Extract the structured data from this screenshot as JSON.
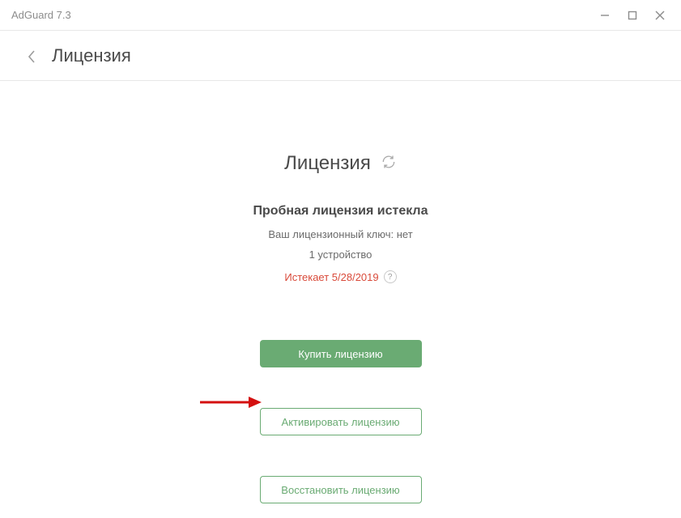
{
  "app": {
    "title": "AdGuard 7.3"
  },
  "header": {
    "title": "Лицензия"
  },
  "section": {
    "title": "Лицензия"
  },
  "status": {
    "trial_expired": "Пробная лицензия истекла",
    "key_line": "Ваш лицензионный ключ: нет",
    "devices_line": "1 устройство",
    "expires_text": "Истекает 5/28/2019",
    "help_symbol": "?"
  },
  "buttons": {
    "buy": "Купить лицензию",
    "activate": "Активировать лицензию",
    "restore": "Восстановить лицензию"
  }
}
